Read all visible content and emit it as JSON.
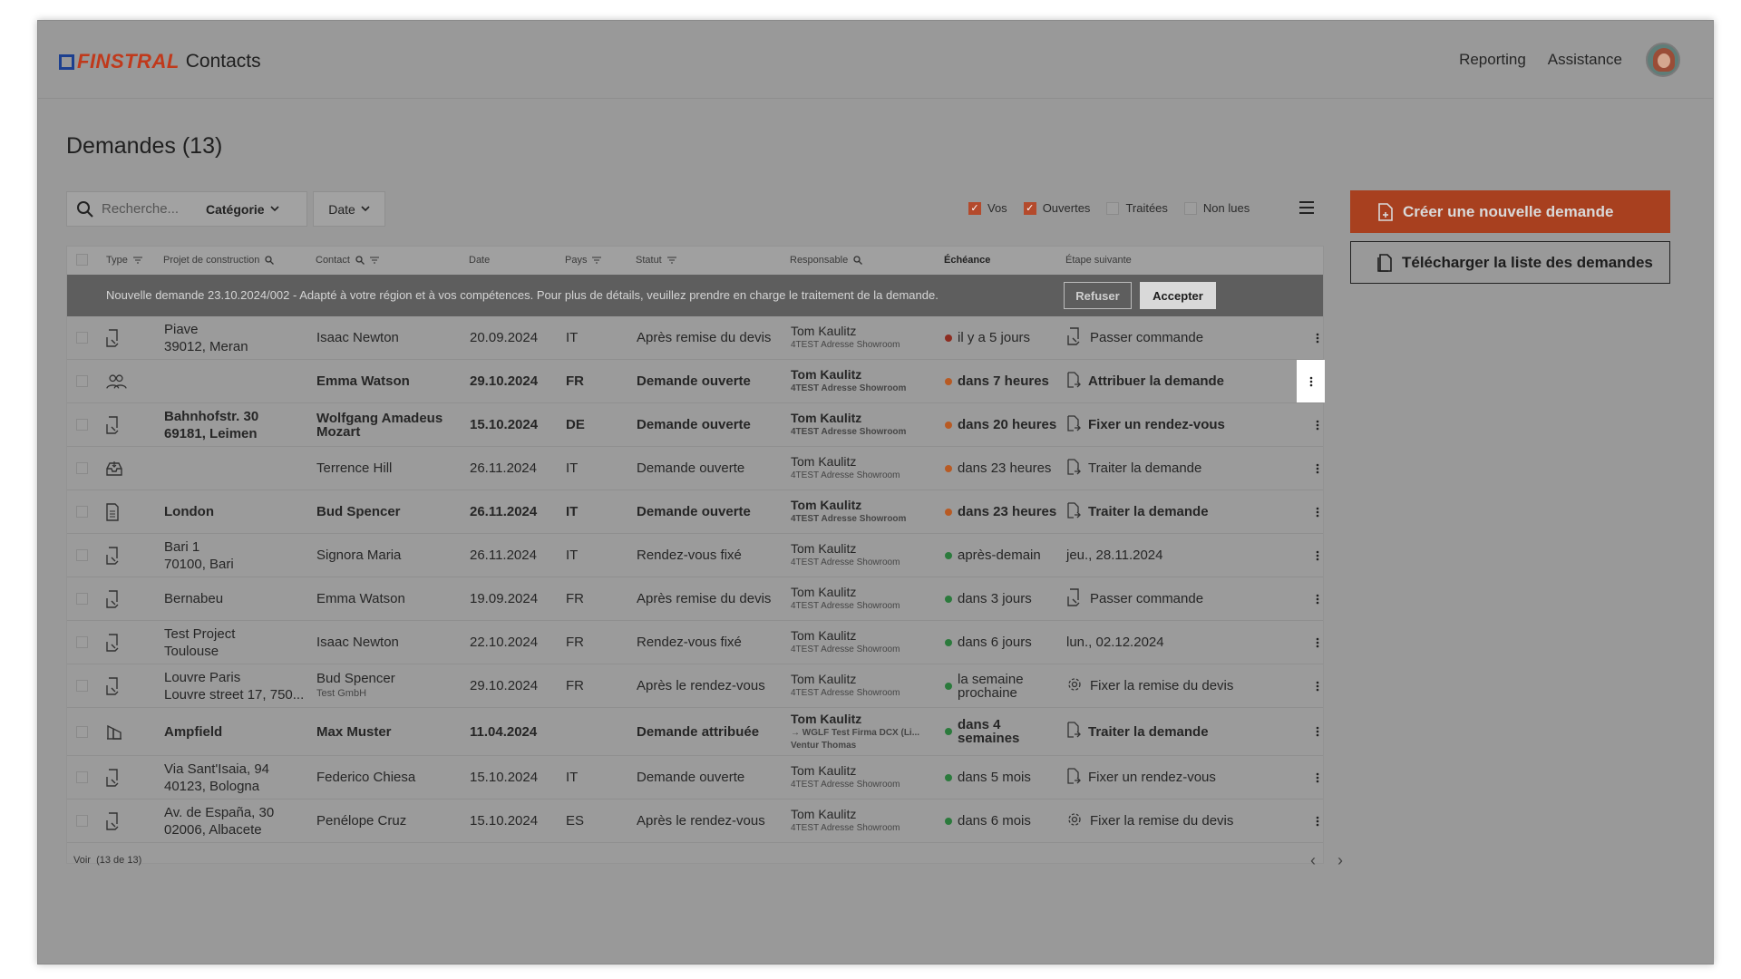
{
  "header": {
    "logo_word": "FINSTRAL",
    "app_name": "Contacts",
    "nav": [
      "Reporting",
      "Assistance"
    ]
  },
  "page": {
    "title": "Demandes (13)"
  },
  "toolbar": {
    "search_placeholder": "Recherche...",
    "category_label": "Catégorie",
    "date_label": "Date",
    "filters": [
      {
        "label": "Vos",
        "checked": true
      },
      {
        "label": "Ouvertes",
        "checked": true
      },
      {
        "label": "Traitées",
        "checked": false
      },
      {
        "label": "Non lues",
        "checked": false
      }
    ]
  },
  "actions": {
    "create_label": "Créer une nouvelle demande",
    "download_label": "Télécharger la liste des demandes"
  },
  "table": {
    "columns": [
      "Type",
      "Projet de construction",
      "Contact",
      "Date",
      "Pays",
      "Statut",
      "Responsable",
      "Échéance",
      "Étape suivante"
    ],
    "notice": {
      "text": "Nouvelle demande 23.10.2024/002 - Adapté à votre région et à vos compétences. Pour plus de détails, veuillez prendre en charge le traitement de la demande.",
      "refuse": "Refuser",
      "accept": "Accepter"
    },
    "rows": [
      {
        "project1": "Piave",
        "project2": "39012, Meran",
        "contact": "Isaac Newton",
        "contact_sub": "",
        "date": "20.09.2024",
        "pays": "IT",
        "statut": "Après remise du devis",
        "resp": "Tom Kaulitz",
        "resp_sub": "4TEST Adresse Showroom",
        "resp_sub2": "",
        "ech": "il y a 5 jours",
        "next": "Passer commande"
      },
      {
        "project1": "",
        "project2": "",
        "contact": "Emma Watson",
        "contact_sub": "",
        "date": "29.10.2024",
        "pays": "FR",
        "statut": "Demande ouverte",
        "resp": "Tom Kaulitz",
        "resp_sub": "4TEST Adresse Showroom",
        "resp_sub2": "",
        "ech": "dans 7 heures",
        "next": "Attribuer la demande"
      },
      {
        "project1": "Bahnhofstr. 30",
        "project2": "69181, Leimen",
        "contact": "Wolfgang Amadeus Mozart",
        "contact_sub": "",
        "date": "15.10.2024",
        "pays": "DE",
        "statut": "Demande ouverte",
        "resp": "Tom Kaulitz",
        "resp_sub": "4TEST Adresse Showroom",
        "resp_sub2": "",
        "ech": "dans 20 heures",
        "next": "Fixer un rendez-vous"
      },
      {
        "project1": "",
        "project2": "",
        "contact": "Terrence Hill",
        "contact_sub": "",
        "date": "26.11.2024",
        "pays": "IT",
        "statut": "Demande ouverte",
        "resp": "Tom Kaulitz",
        "resp_sub": "4TEST Adresse Showroom",
        "resp_sub2": "",
        "ech": "dans 23 heures",
        "next": "Traiter la demande"
      },
      {
        "project1": "London",
        "project2": "",
        "contact": "Bud Spencer",
        "contact_sub": "",
        "date": "26.11.2024",
        "pays": "IT",
        "statut": "Demande ouverte",
        "resp": "Tom Kaulitz",
        "resp_sub": "4TEST Adresse Showroom",
        "resp_sub2": "",
        "ech": "dans 23 heures",
        "next": "Traiter la demande"
      },
      {
        "project1": "Bari 1",
        "project2": "70100, Bari",
        "contact": "Signora Maria",
        "contact_sub": "",
        "date": "26.11.2024",
        "pays": "IT",
        "statut": "Rendez-vous fixé",
        "resp": "Tom Kaulitz",
        "resp_sub": "4TEST Adresse Showroom",
        "resp_sub2": "",
        "ech": "après-demain",
        "next": "jeu., 28.11.2024"
      },
      {
        "project1": "Bernabeu",
        "project2": "",
        "contact": "Emma Watson",
        "contact_sub": "",
        "date": "19.09.2024",
        "pays": "FR",
        "statut": "Après remise du devis",
        "resp": "Tom Kaulitz",
        "resp_sub": "4TEST Adresse Showroom",
        "resp_sub2": "",
        "ech": "dans 3 jours",
        "next": "Passer commande"
      },
      {
        "project1": "Test Project",
        "project2": "Toulouse",
        "contact": "Isaac Newton",
        "contact_sub": "",
        "date": "22.10.2024",
        "pays": "FR",
        "statut": "Rendez-vous fixé",
        "resp": "Tom Kaulitz",
        "resp_sub": "4TEST Adresse Showroom",
        "resp_sub2": "",
        "ech": "dans 6 jours",
        "next": "lun., 02.12.2024"
      },
      {
        "project1": "Louvre Paris",
        "project2": "Louvre street 17, 750...",
        "contact": "Bud Spencer",
        "contact_sub": "Test GmbH",
        "date": "29.10.2024",
        "pays": "FR",
        "statut": "Après le rendez-vous",
        "resp": "Tom Kaulitz",
        "resp_sub": "4TEST Adresse Showroom",
        "resp_sub2": "",
        "ech": "la semaine prochaine",
        "next": "Fixer la remise du devis"
      },
      {
        "project1": "Ampfield",
        "project2": "",
        "contact": "Max Muster",
        "contact_sub": "",
        "date": "11.04.2024",
        "pays": "",
        "statut": "Demande attribuée",
        "resp": "Tom Kaulitz",
        "resp_sub": "→ WGLF Test Firma DCX (Li...",
        "resp_sub2": "Ventur Thomas",
        "ech": "dans 4 semaines",
        "next": "Traiter la demande"
      },
      {
        "project1": "Via Sant'Isaia, 94",
        "project2": "40123, Bologna",
        "contact": "Federico Chiesa",
        "contact_sub": "",
        "date": "15.10.2024",
        "pays": "IT",
        "statut": "Demande ouverte",
        "resp": "Tom Kaulitz",
        "resp_sub": "4TEST Adresse Showroom",
        "resp_sub2": "",
        "ech": "dans 5 mois",
        "next": "Fixer un rendez-vous"
      },
      {
        "project1": "Av. de España, 30",
        "project2": "02006, Albacete",
        "contact": "Penélope Cruz",
        "contact_sub": "",
        "date": "15.10.2024",
        "pays": "ES",
        "statut": "Après le rendez-vous",
        "resp": "Tom Kaulitz",
        "resp_sub": "4TEST Adresse Showroom",
        "resp_sub2": "",
        "ech": "dans 6 mois",
        "next": "Fixer la remise du devis"
      }
    ],
    "footer": {
      "voir": "Voir",
      "count": "(13 de 13)"
    }
  },
  "colors": {
    "accent": "#a8401f",
    "overlay": "#999999",
    "notice_bg": "#5e5e5e"
  }
}
